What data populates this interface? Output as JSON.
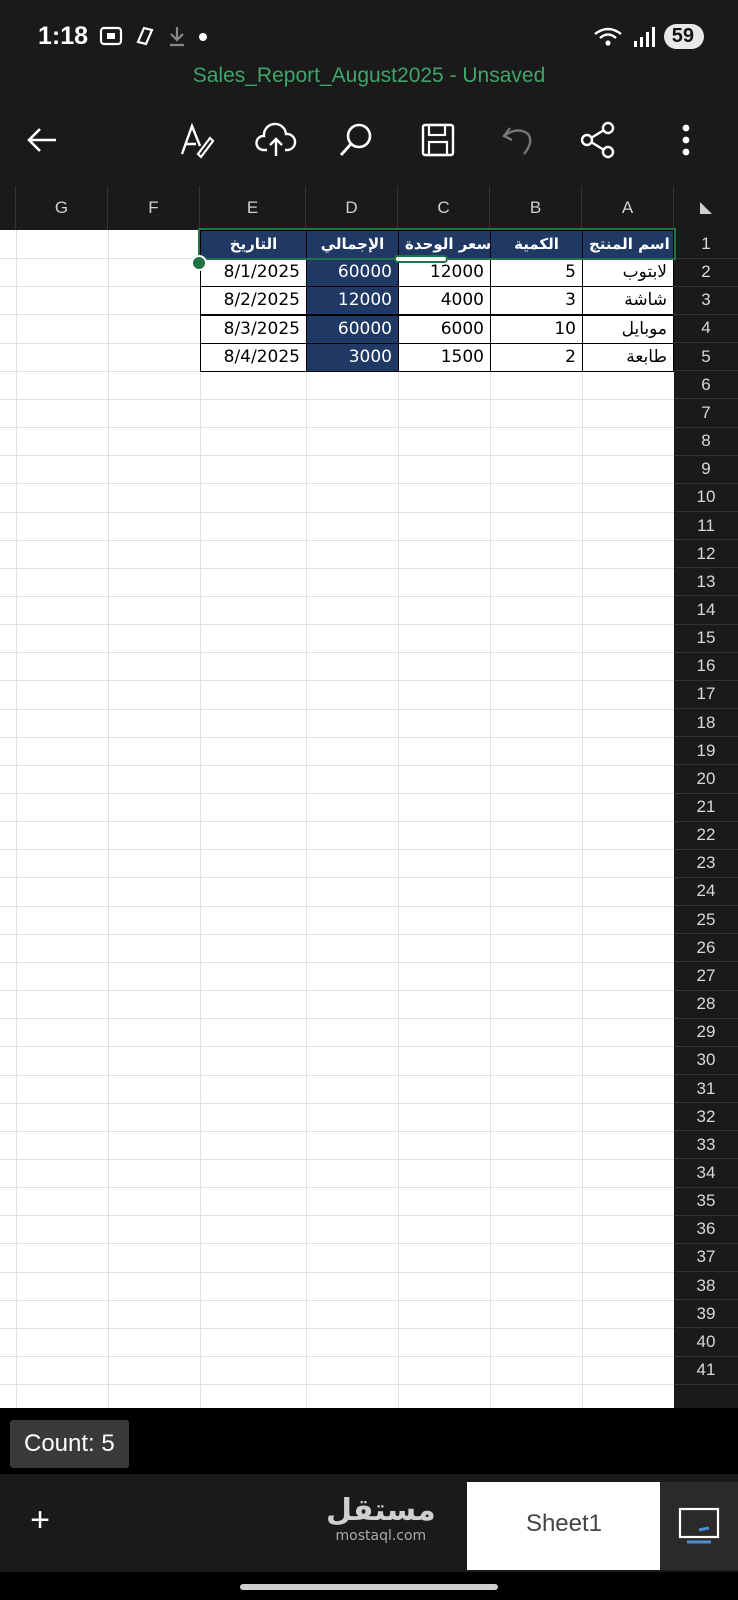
{
  "status_bar": {
    "time": "1:18",
    "battery": "59"
  },
  "document": {
    "title": "Sales_Report_August2025 - Unsaved"
  },
  "toolbar": {
    "icons": [
      "back-arrow-icon",
      "text-format-icon",
      "cloud-upload-icon",
      "search-icon",
      "save-icon",
      "undo-icon",
      "share-icon",
      "more-options-icon"
    ]
  },
  "columns": [
    "G",
    "F",
    "E",
    "D",
    "C",
    "B",
    "A"
  ],
  "rows": [
    "1",
    "2",
    "3",
    "4",
    "5",
    "6",
    "7",
    "8",
    "9",
    "10",
    "11",
    "12",
    "13",
    "14",
    "15",
    "16",
    "17",
    "18",
    "19",
    "20",
    "21",
    "22",
    "23",
    "24",
    "25",
    "26",
    "27",
    "28",
    "29",
    "30",
    "31",
    "32",
    "33",
    "34",
    "35",
    "36",
    "37",
    "38",
    "39",
    "40",
    "41"
  ],
  "table": {
    "headers": {
      "A": "اسم المنتج",
      "B": "الكمية",
      "C": "سعر الوحدة",
      "D": "الإجمالي",
      "E": "التاريخ"
    },
    "rows": [
      {
        "A": "لابتوب",
        "B": "5",
        "C": "12000",
        "D": "60000",
        "E": "8/1/2025"
      },
      {
        "A": "شاشة",
        "B": "3",
        "C": "4000",
        "D": "12000",
        "E": "8/2/2025"
      },
      {
        "A": "موبايل",
        "B": "10",
        "C": "6000",
        "D": "60000",
        "E": "8/3/2025"
      },
      {
        "A": "طابعة",
        "B": "2",
        "C": "1500",
        "D": "3000",
        "E": "8/4/2025"
      }
    ]
  },
  "status": {
    "count_label": "Count: 5"
  },
  "sheets": {
    "add_label": "+",
    "active_sheet": "Sheet1"
  },
  "watermark": {
    "arabic": "مستقل",
    "url": "mostaql.com"
  },
  "colors": {
    "header_fill": "#1f3864",
    "selection": "#217346",
    "title": "#3fa56b"
  }
}
